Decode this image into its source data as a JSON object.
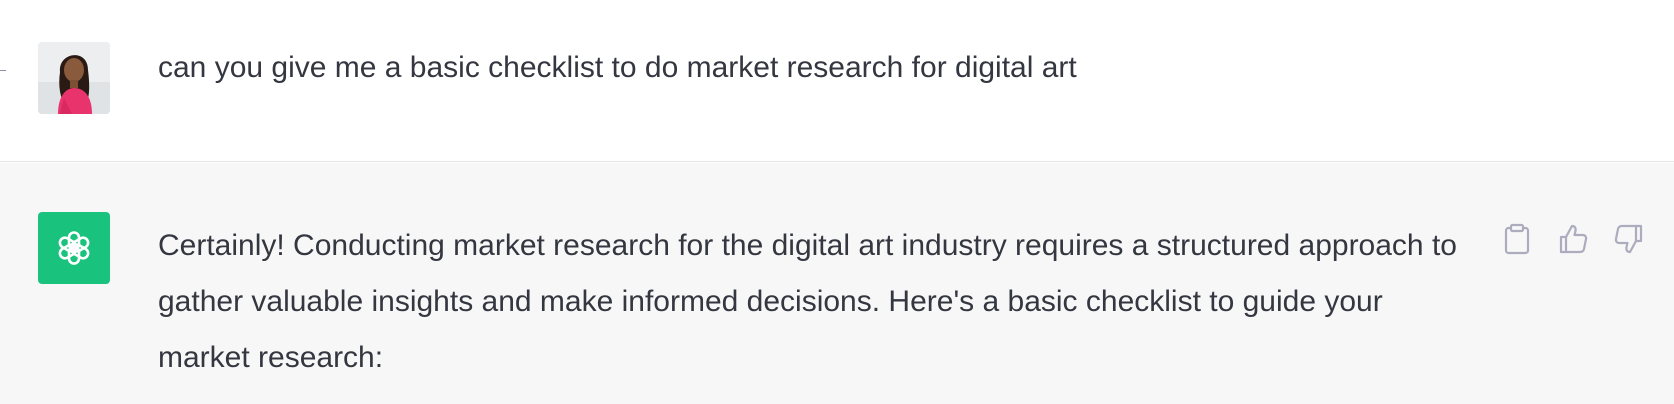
{
  "conversation": {
    "user_message": {
      "avatar_icon": "user-photo-avatar",
      "text": "can you give me a basic checklist to do market research for digital art"
    },
    "assistant_message": {
      "avatar_icon": "openai-logo-icon",
      "avatar_color": "#19c37d",
      "text": "Certainly! Conducting market research for the digital art industry requires a structured approach to gather valuable insights and make informed decisions. Here's a basic checklist to guide your market research:"
    },
    "actions": {
      "copy_icon": "clipboard-icon",
      "like_icon": "thumbs-up-icon",
      "dislike_icon": "thumbs-down-icon"
    }
  },
  "colors": {
    "user_bg": "#ffffff",
    "assistant_bg": "#f7f7f8",
    "text": "#353740",
    "icon": "#acacbe",
    "divider": "#e5e5e5"
  }
}
